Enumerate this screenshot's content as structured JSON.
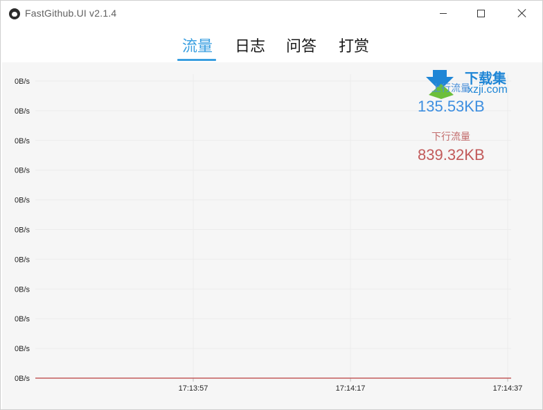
{
  "window": {
    "title": "FastGithub.UI v2.1.4"
  },
  "tabs": [
    {
      "label": "流量",
      "active": true
    },
    {
      "label": "日志",
      "active": false
    },
    {
      "label": "问答",
      "active": false
    },
    {
      "label": "打赏",
      "active": false
    }
  ],
  "stats": {
    "upload_label": "上行流量",
    "upload_value": "135.53KB",
    "download_label": "下行流量",
    "download_value": "839.32KB"
  },
  "watermark": {
    "brand": "下载集",
    "url": "xzji.com"
  },
  "colors": {
    "accent": "#3a9fe0",
    "upload": "#3d8ee0",
    "download": "#c25a5a"
  },
  "chart_data": {
    "type": "line",
    "y_tick_labels": [
      "0B/s",
      "0B/s",
      "0B/s",
      "0B/s",
      "0B/s",
      "0B/s",
      "0B/s",
      "0B/s",
      "0B/s",
      "0B/s",
      "0B/s"
    ],
    "x_tick_labels": [
      "17:13:57",
      "17:14:17",
      "17:14:37"
    ],
    "series": [
      {
        "name": "下行流量",
        "color": "#c25a5a",
        "values": [
          0,
          0,
          0,
          0
        ]
      }
    ],
    "grid": true
  }
}
